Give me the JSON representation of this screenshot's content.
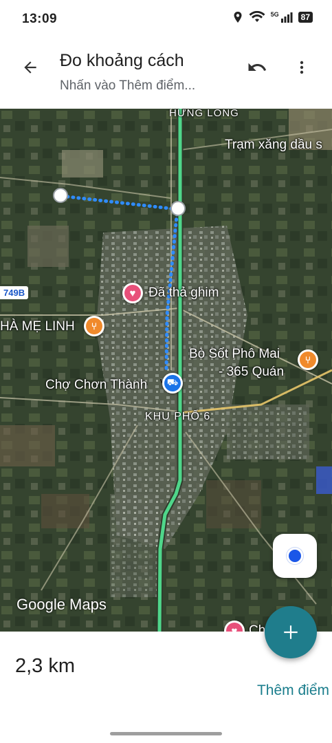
{
  "status_bar": {
    "time": "13:09",
    "battery": "87",
    "network": "5G"
  },
  "header": {
    "title": "Đo khoảng cách",
    "subtitle": "Nhấn vào Thêm điểm..."
  },
  "map": {
    "labels": {
      "hung_long": "HƯNG LONG",
      "gas_station": "Trạm xăng dầu s",
      "dropped_pin": "Đã thả ghim",
      "restaurant_left": "HÀ MẸ LINH",
      "restaurant_right_line1": "Bò Sốt Phô Mai",
      "restaurant_right_line2": "- 365 Quán",
      "market": "Chợ Chơn Thành",
      "khu_pho": "KHU PHỐ 6",
      "bottom_place": "Ch",
      "road_number": "749B",
      "google_maps": "Google Maps"
    }
  },
  "bottom": {
    "distance": "2,3 km",
    "add_point": "Thêm điểm"
  },
  "icons": {
    "back": "arrow-left-icon",
    "undo": "undo-icon",
    "more": "more-vert-icon",
    "add": "plus-icon",
    "locate": "my-location-icon"
  },
  "colors": {
    "accent": "#1f7d8c",
    "route_highlight": "#4fd68a",
    "measure_line": "#2f8cff",
    "heart_pin": "#e8507a",
    "food_pin": "#f08a2c"
  }
}
